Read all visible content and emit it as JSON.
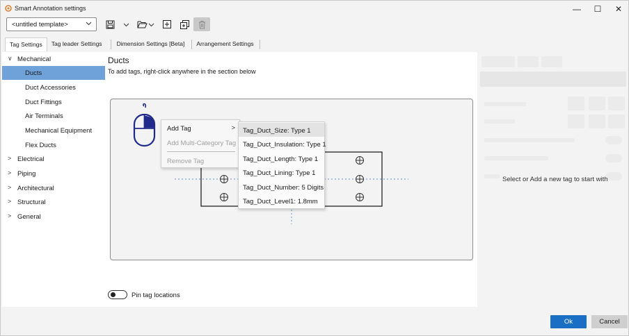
{
  "window": {
    "title": "Smart Annotation settings",
    "minimize": "—",
    "maximize": "☐",
    "close": "✕"
  },
  "toolbar": {
    "template_value": "<untitled template>"
  },
  "tabs": [
    {
      "label": "Tag Settings"
    },
    {
      "label": "Tag leader Settings"
    },
    {
      "label": "Dimension Settings [Beta]"
    },
    {
      "label": "Arrangement Settings"
    }
  ],
  "tree": {
    "items": [
      {
        "label": "Mechanical",
        "expanded": true
      },
      {
        "label": "Ducts"
      },
      {
        "label": "Duct Accessories"
      },
      {
        "label": "Duct Fittings"
      },
      {
        "label": "Air Terminals"
      },
      {
        "label": "Mechanical Equipment"
      },
      {
        "label": "Flex Ducts"
      },
      {
        "label": "Electrical"
      },
      {
        "label": "Piping"
      },
      {
        "label": "Architectural"
      },
      {
        "label": "Structural"
      },
      {
        "label": "General"
      }
    ],
    "expanded_arrow": "∨",
    "collapsed_arrow": ">"
  },
  "main": {
    "section_title": "Ducts",
    "hint": "To add tags, right-click anywhere in the section below",
    "pin_label": "Pin tag locations"
  },
  "context_menu": {
    "items": [
      {
        "label": "Add Tag",
        "chevron": ">"
      },
      {
        "label": "Add Multi-Category Tag"
      },
      {
        "label": "Remove Tag"
      }
    ],
    "submenu": [
      {
        "label": "Tag_Duct_Size: Type 1"
      },
      {
        "label": "Tag_Duct_Insulation: Type 1"
      },
      {
        "label": "Tag_Duct_Length: Type 1"
      },
      {
        "label": "Tag_Duct_Lining: Type 1"
      },
      {
        "label": "Tag_Duct_Number: 5 Digits"
      },
      {
        "label": "Tag_Duct_Level1: 1.8mm"
      }
    ]
  },
  "right_panel": {
    "message": "Select or Add a new tag to start with"
  },
  "footer": {
    "ok": "Ok",
    "cancel": "Cancel"
  },
  "colors": {
    "accent": "#1a6fc4",
    "selection": "#6ea2d8",
    "mouse_icon": "#1f2a8a"
  }
}
